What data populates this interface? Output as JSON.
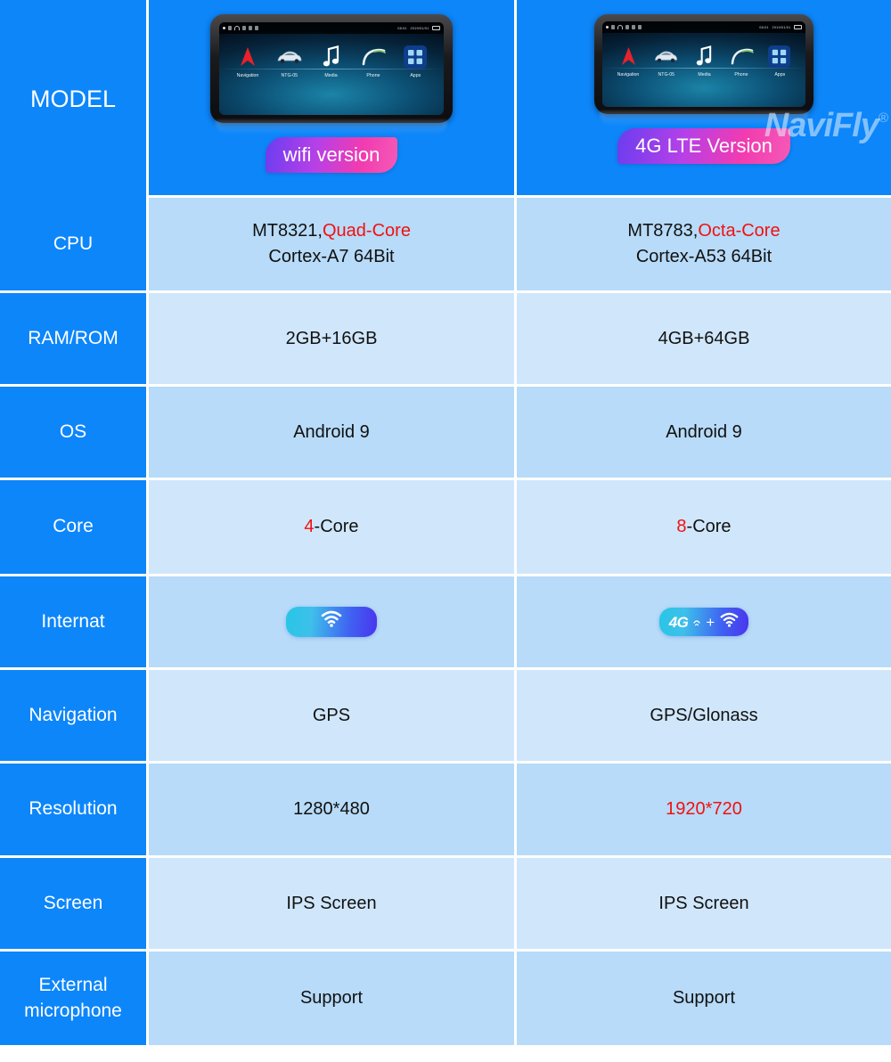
{
  "header": {
    "label": "MODEL",
    "watermark": "NaviFly",
    "watermark_reg": "®",
    "columns": [
      {
        "badge": "wifi version",
        "device": {
          "status_time": "08:01",
          "status_date": "2019/01/01",
          "apps": [
            {
              "name": "Navigation",
              "icon": "navigation-arrow-icon"
            },
            {
              "name": "NTG-05",
              "icon": "car-icon"
            },
            {
              "name": "Media",
              "icon": "music-note-icon"
            },
            {
              "name": "Phone",
              "icon": "phone-handset-icon"
            },
            {
              "name": "Apps",
              "icon": "app-grid-icon"
            }
          ]
        }
      },
      {
        "badge": "4G LTE Version",
        "device": {
          "status_time": "08:01",
          "status_date": "2019/01/01",
          "apps": [
            {
              "name": "Navigation",
              "icon": "navigation-arrow-icon"
            },
            {
              "name": "NTG-05",
              "icon": "car-icon"
            },
            {
              "name": "Media",
              "icon": "music-note-icon"
            },
            {
              "name": "Phone",
              "icon": "phone-handset-icon"
            },
            {
              "name": "Apps",
              "icon": "app-grid-icon"
            }
          ]
        }
      }
    ]
  },
  "colors": {
    "label_blue": "#0d86fa",
    "row_shade_a": "#b7dbf8",
    "row_shade_b": "#d0e7fb",
    "highlight_red": "#f21010",
    "badge_gradient_start": "#6a3df0",
    "badge_gradient_end": "#f45ab6",
    "net_pill_start": "#27c6e6",
    "net_pill_end": "#4a34ee"
  },
  "rows": [
    {
      "label": "CPU",
      "left": {
        "line1_plain": "MT8321,",
        "line1_red": "Quad-Core",
        "line2": "Cortex-A7 64Bit"
      },
      "right": {
        "line1_plain": "MT8783,",
        "line1_red": "Octa-Core",
        "line2": "Cortex-A53 64Bit"
      }
    },
    {
      "label": "RAM/ROM",
      "left": {
        "value": "2GB+16GB"
      },
      "right": {
        "value": "4GB+64GB"
      }
    },
    {
      "label": "OS",
      "left": {
        "value": "Android 9"
      },
      "right": {
        "value": "Android 9"
      }
    },
    {
      "label": "Core",
      "left": {
        "red_prefix": "4",
        "value": "-Core"
      },
      "right": {
        "red_prefix": "8",
        "value": "-Core"
      }
    },
    {
      "label": "Internat",
      "left": {
        "pill": "wifi-icon"
      },
      "right": {
        "pill_text_4g": "4G",
        "pill_plus": "+",
        "pill": "wifi-icon"
      }
    },
    {
      "label": "Navigation",
      "left": {
        "value": "GPS"
      },
      "right": {
        "value": "GPS/Glonass"
      }
    },
    {
      "label": "Resolution",
      "left": {
        "value": "1280*480"
      },
      "right": {
        "value_red": "1920*720"
      }
    },
    {
      "label": "Screen",
      "left": {
        "value": "IPS Screen"
      },
      "right": {
        "value": "IPS Screen"
      }
    },
    {
      "label": "External microphone",
      "label_line1": "External",
      "label_line2": "microphone",
      "left": {
        "value": "Support"
      },
      "right": {
        "value": "Support"
      }
    }
  ]
}
